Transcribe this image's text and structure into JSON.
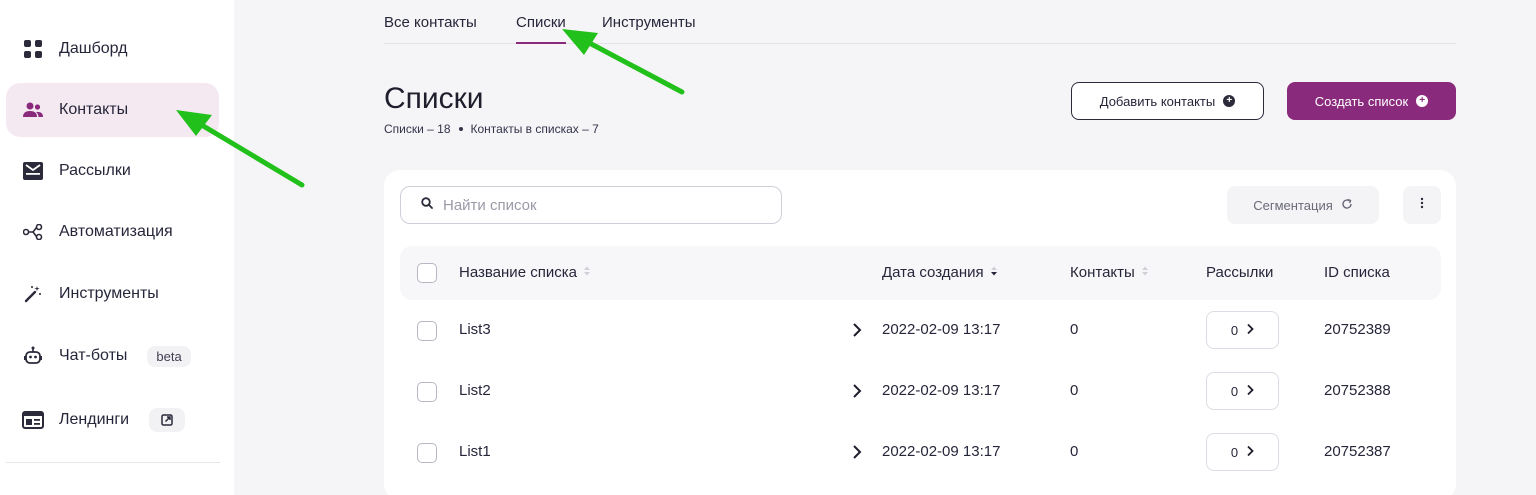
{
  "sidebar": {
    "items": [
      {
        "label": "Дашборд",
        "icon": "dashboard-grid-icon"
      },
      {
        "label": "Контакты",
        "icon": "users-icon"
      },
      {
        "label": "Рассылки",
        "icon": "mail-inbox-icon"
      },
      {
        "label": "Автоматизация",
        "icon": "flow-nodes-icon"
      },
      {
        "label": "Инструменты",
        "icon": "magic-wand-icon"
      },
      {
        "label": "Чат-боты",
        "icon": "robot-icon",
        "badge": "beta"
      },
      {
        "label": "Лендинги",
        "icon": "landing-page-icon",
        "external_icon": "external-link-icon"
      }
    ],
    "active_index": 1
  },
  "tabs": [
    {
      "label": "Все контакты"
    },
    {
      "label": "Списки"
    },
    {
      "label": "Инструменты"
    }
  ],
  "header": {
    "title": "Списки",
    "stats": {
      "lists": "Списки – 18",
      "contacts": "Контакты в списках – 7"
    },
    "add_contacts_label": "Добавить контакты",
    "create_list_label": "Создать список"
  },
  "toolbar": {
    "search_placeholder": "Найти список",
    "segmentation_label": "Сегментация"
  },
  "table": {
    "columns": [
      "Название списка",
      "Дата создания",
      "Контакты",
      "Рассылки",
      "ID списка"
    ],
    "rows": [
      {
        "name": "List3",
        "created": "2022-02-09 13:17",
        "contacts": "0",
        "mailings": "0",
        "id": "20752389"
      },
      {
        "name": "List2",
        "created": "2022-02-09 13:17",
        "contacts": "0",
        "mailings": "0",
        "id": "20752388"
      },
      {
        "name": "List1",
        "created": "2022-02-09 13:17",
        "contacts": "0",
        "mailings": "0",
        "id": "20752387"
      }
    ]
  },
  "colors": {
    "accent": "#8a2a7c",
    "active_nav_bg": "#f4e9f1",
    "annotation_arrow": "#22c01a"
  }
}
